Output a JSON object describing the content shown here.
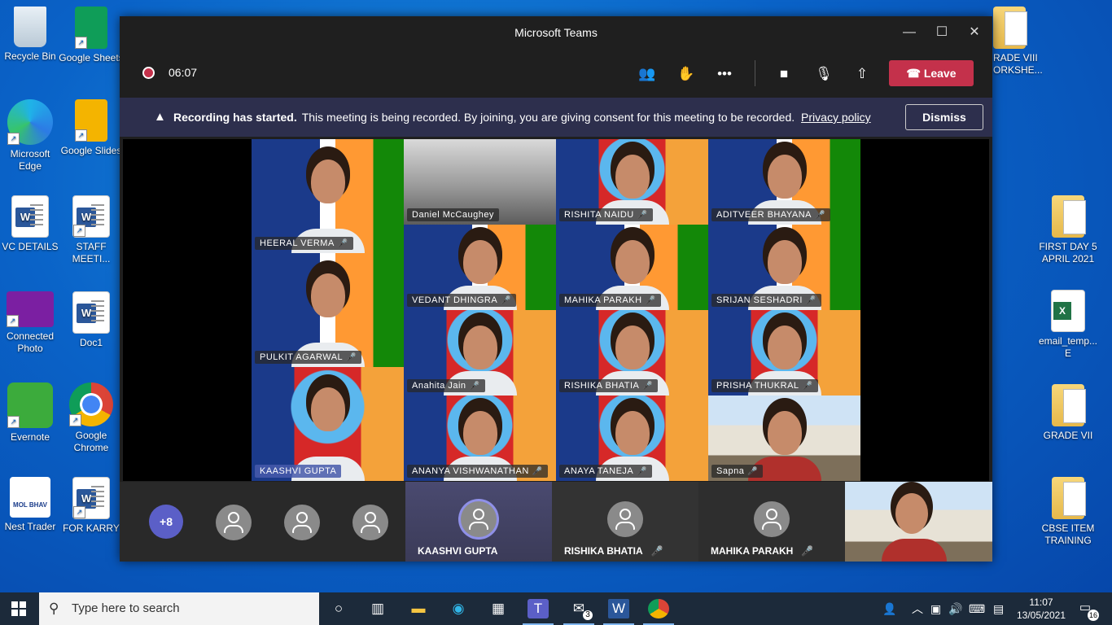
{
  "desktop": {
    "left_icons": [
      {
        "label": "Recycle Bin"
      },
      {
        "label": "Google Sheets"
      },
      {
        "label": "Microsoft Edge"
      },
      {
        "label": "Google Slides"
      },
      {
        "label": "VC DETAILS"
      },
      {
        "label": "STAFF MEETI..."
      },
      {
        "label": "Connected Photo"
      },
      {
        "label": "Doc1"
      },
      {
        "label": "Evernote"
      },
      {
        "label": "Google Chrome"
      },
      {
        "label": "Nest Trader"
      },
      {
        "label": "FOR KARRY"
      }
    ],
    "right_icons": [
      {
        "label": "RADE VIII ORKSHE..."
      },
      {
        "label": "FIRST DAY 5 APRIL 2021"
      },
      {
        "label": "email_temp... E"
      },
      {
        "label": "GRADE VII"
      },
      {
        "label": "CBSE ITEM TRAINING"
      }
    ],
    "nest_logo_text": "MOL BHAV"
  },
  "window": {
    "title": "Microsoft Teams",
    "minimize": "—",
    "maximize": "☐",
    "close": "✕"
  },
  "toolbar": {
    "timer": "06:07",
    "leave_label": "Leave"
  },
  "banner": {
    "title": "Recording has started.",
    "message": "This meeting is being recorded. By joining, you are giving consent for this meeting to be recorded.",
    "link": "Privacy policy",
    "dismiss": "Dismiss"
  },
  "participants_grid": [
    {
      "name": "HEERAL VERMA"
    },
    {
      "name": "Daniel McCaughey"
    },
    {
      "name": "RISHITA NAIDU"
    },
    {
      "name": "ADITVEER BHAYANA"
    },
    {
      "name": "VEDANT DHINGRA"
    },
    {
      "name": "MAHIKA PARAKH"
    },
    {
      "name": "SRIJAN SESHADRI"
    },
    {
      "name": "PULKIT AGARWAL"
    },
    {
      "name": "Anahita Jain"
    },
    {
      "name": "RISHIKA BHATIA"
    },
    {
      "name": "PRISHA THUKRAL"
    },
    {
      "name": "KAASHVI GUPTA"
    },
    {
      "name": "ANANYA VISHWANATHAN"
    },
    {
      "name": "ANAYA TANEJA"
    },
    {
      "name": "Sapna"
    }
  ],
  "strip": {
    "overflow": "+8",
    "tiles": [
      {
        "name": "KAASHVI GUPTA"
      },
      {
        "name": "RISHIKA BHATIA"
      },
      {
        "name": "MAHIKA PARAKH"
      }
    ]
  },
  "taskbar": {
    "search_placeholder": "Type here to search",
    "mail_badge": "3",
    "time": "11:07",
    "date": "13/05/2021",
    "notification_count": "16"
  }
}
